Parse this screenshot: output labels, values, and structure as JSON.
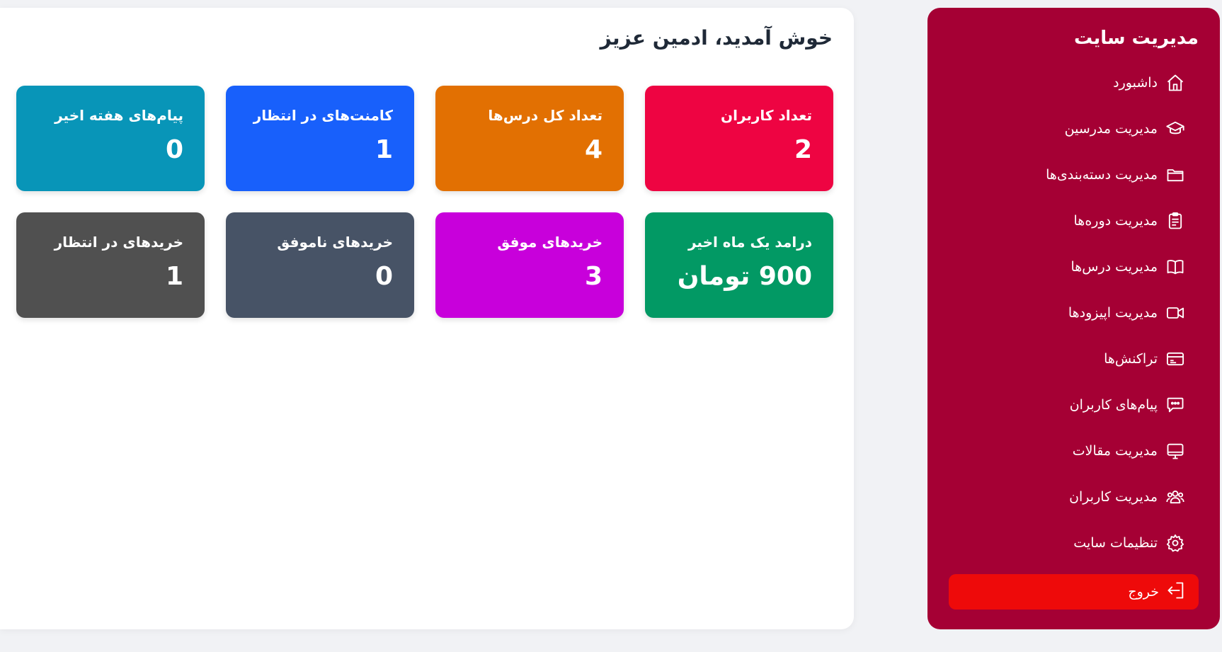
{
  "welcome": "خوش آمدید، ادمین عزیز",
  "cards": [
    {
      "title": "تعداد کاربران",
      "value": "2",
      "color": "#ee0442"
    },
    {
      "title": "تعداد کل درس‌ها",
      "value": "4",
      "color": "#e27002"
    },
    {
      "title": "کامنت‌های در انتظار",
      "value": "1",
      "color": "#1860fb"
    },
    {
      "title": "پیام‌های هفته اخیر",
      "value": "0",
      "color": "#0895b8"
    },
    {
      "title": "درامد یک ماه اخیر",
      "value": "900 تومان",
      "color": "#029964"
    },
    {
      "title": "خریدهای موفق",
      "value": "3",
      "color": "#c800db"
    },
    {
      "title": "خریدهای ناموفق",
      "value": "0",
      "color": "#475366"
    },
    {
      "title": "خریدهای در انتظار",
      "value": "1",
      "color": "#505050"
    }
  ],
  "sidebar": {
    "title": "مدیریت سایت",
    "background": "#a50034",
    "items": [
      {
        "label": "داشبورد",
        "icon": "home-icon"
      },
      {
        "label": "مدیریت مدرسین",
        "icon": "graduation-cap-icon"
      },
      {
        "label": "مدیریت دسته‌بندی‌ها",
        "icon": "folder-icon"
      },
      {
        "label": "مدیریت دوره‌ها",
        "icon": "clipboard-icon"
      },
      {
        "label": "مدیریت درس‌ها",
        "icon": "book-icon"
      },
      {
        "label": "مدیریت اپیزودها",
        "icon": "video-icon"
      },
      {
        "label": "تراکنش‌ها",
        "icon": "credit-card-icon"
      },
      {
        "label": "پیام‌های کاربران",
        "icon": "chat-icon"
      },
      {
        "label": "مدیریت مقالات",
        "icon": "monitor-icon"
      },
      {
        "label": "مدیریت کاربران",
        "icon": "users-icon"
      },
      {
        "label": "تنظیمات سایت",
        "icon": "gear-icon"
      }
    ],
    "logout": {
      "label": "خروج",
      "icon": "logout-icon",
      "color": "#ee0a0a"
    }
  }
}
